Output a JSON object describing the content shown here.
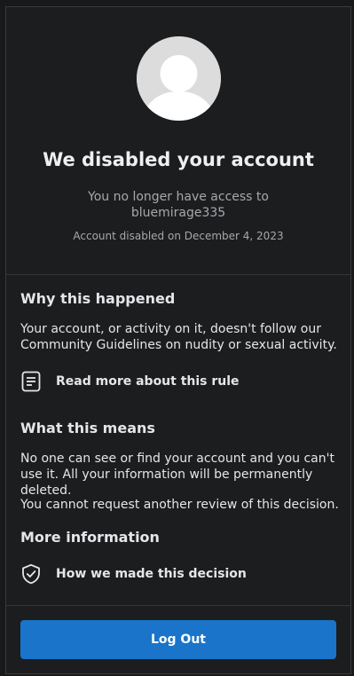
{
  "header": {
    "title": "We disabled your account",
    "subtitle": "You no longer have access to bluemirage335",
    "disabled_date": "Account disabled on December 4, 2023"
  },
  "why": {
    "heading": "Why this happened",
    "body": "Your account, or activity on it, doesn't follow our Community Guidelines on nudity or sexual activity.",
    "link_label": "Read more about this rule",
    "link_icon": "document-icon"
  },
  "means": {
    "heading": "What this means",
    "body1": "No one can see or find your account and you can't use it. All your information will be permanently deleted.",
    "body2": "You cannot request another review of this decision."
  },
  "more": {
    "heading": "More information",
    "link_label": "How we made this decision",
    "link_icon": "shield-check-icon"
  },
  "footer": {
    "logout_label": "Log Out",
    "button_color": "#1a74c9"
  }
}
